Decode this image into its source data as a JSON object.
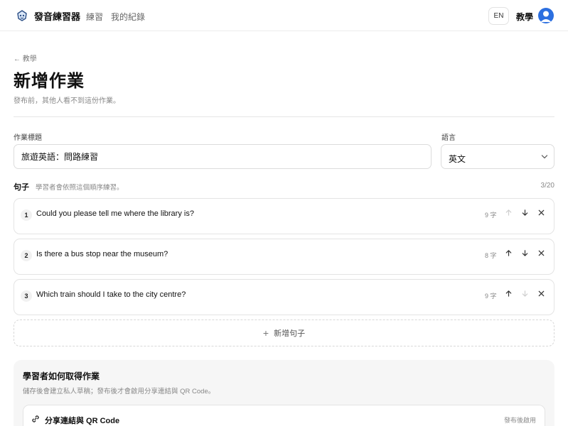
{
  "app": {
    "name": "發音練習器",
    "icon": "brand-mascot-icon",
    "nav": {
      "practice": "練習",
      "records": "我的紀錄"
    },
    "lang_toggle": "EN",
    "role": "教學",
    "accent": "#2c6fe0"
  },
  "page": {
    "back_label": "← 教學",
    "title": "新增作業",
    "subtitle": "發布前，其他人看不到這份作業。"
  },
  "form": {
    "title_label": "作業標題",
    "title_value": "旅遊英語：問路練習",
    "language_label": "語言",
    "language_value": "英文"
  },
  "sentences": {
    "heading": "句子",
    "hint": "學習者會依照這個順序練習。",
    "count": "3/20",
    "items": [
      {
        "num": "1",
        "text": "Could you please tell me where the library is?",
        "chars": "9 字"
      },
      {
        "num": "2",
        "text": "Is there a bus stop near the museum?",
        "chars": "8 字"
      },
      {
        "num": "3",
        "text": "Which train should I take to the city centre?",
        "chars": "9 字"
      }
    ],
    "add_label": "新增句子"
  },
  "distribution": {
    "title": "學習者如何取得作業",
    "description": "儲存後會建立私人草稿；發布後才會啟用分享連結與 QR Code。",
    "share_title": "分享連結與 QR Code",
    "share_status": "發布後啟用"
  }
}
